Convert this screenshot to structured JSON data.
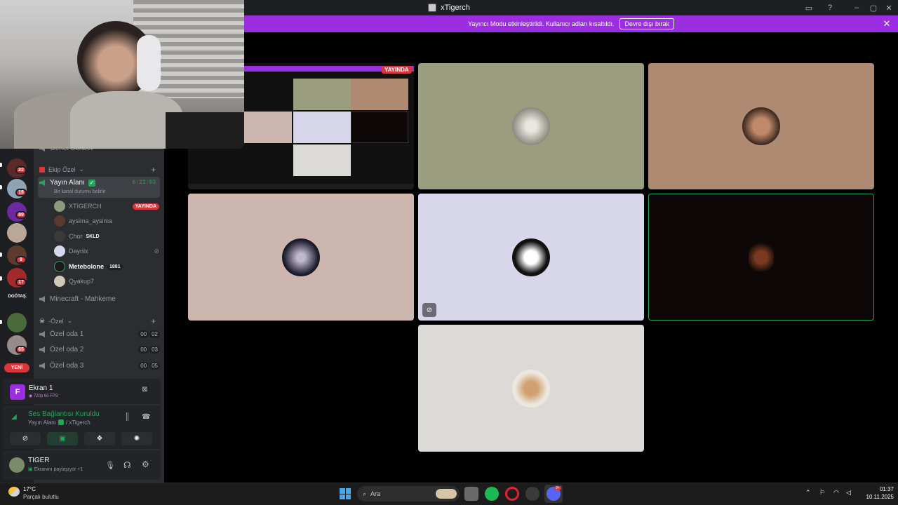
{
  "window": {
    "title": "xTigerch"
  },
  "banner": {
    "text": "Yayıncı Modu etkinleştirildi. Kullanıcı adları kısaltıldı.",
    "button": "Devre dışı bırak"
  },
  "channels": {
    "general_voice": "Genel Sohbet",
    "category_1": "Ekip Özel",
    "active_channel": {
      "name": "Yayın Alanı",
      "timer": "6:23:03",
      "status": "Bir kanal durumu belirle"
    },
    "members": [
      {
        "name": "XTİGERCH",
        "tag": "YAYINDA"
      },
      {
        "name": "aysima_aysima"
      },
      {
        "name": "Chor",
        "tag": "SKLD"
      },
      {
        "name": "Daynlx"
      },
      {
        "name": "Metebolone",
        "tag": "1881"
      },
      {
        "name": "Qyakup7"
      }
    ],
    "other_voice": "Minecraft - Mahkeme",
    "category_2": "-Özel",
    "rooms": [
      {
        "name": "Özel oda 1",
        "c1": "00",
        "c2": "02"
      },
      {
        "name": "Özel oda 2",
        "c1": "00",
        "c2": "03"
      },
      {
        "name": "Özel oda 3",
        "c1": "00",
        "c2": "05"
      }
    ]
  },
  "rail": {
    "badges": [
      "22",
      "18",
      "89",
      "8",
      "17",
      "65"
    ],
    "server_text": "DGÖTAŞ.",
    "new_label": "YENİ"
  },
  "stream_panel": {
    "avatar_letter": "F",
    "title": "Ekran 1",
    "quality": "720p 60 FPS"
  },
  "voice_panel": {
    "title": "Ses Bağlantısı Kuruldu",
    "channel": "Yayın Alanı",
    "user": "/ xTigerch"
  },
  "user_panel": {
    "name": "TIGER",
    "status": "Ekranını paylaşıyor +1"
  },
  "stream_tile": {
    "live_label": "YAYINDA"
  },
  "tiles": [
    {
      "bg": "#9a9d7e"
    },
    {
      "bg": "#ae8a73"
    },
    {
      "bg": "#cdb6ae"
    },
    {
      "bg": "#d8d6ea"
    },
    {
      "bg": "#0d0807"
    },
    {
      "bg": "#dcdad6"
    }
  ],
  "taskbar": {
    "weather_temp": "17°C",
    "weather_desc": "Parçalı bulutlu",
    "search": "Ara",
    "time": "01:37",
    "date": "10.11.2025",
    "discord_badge": "9+"
  },
  "colors": {
    "accent": "#9b2ee0",
    "live": "#da373c",
    "online": "#23a55a"
  }
}
